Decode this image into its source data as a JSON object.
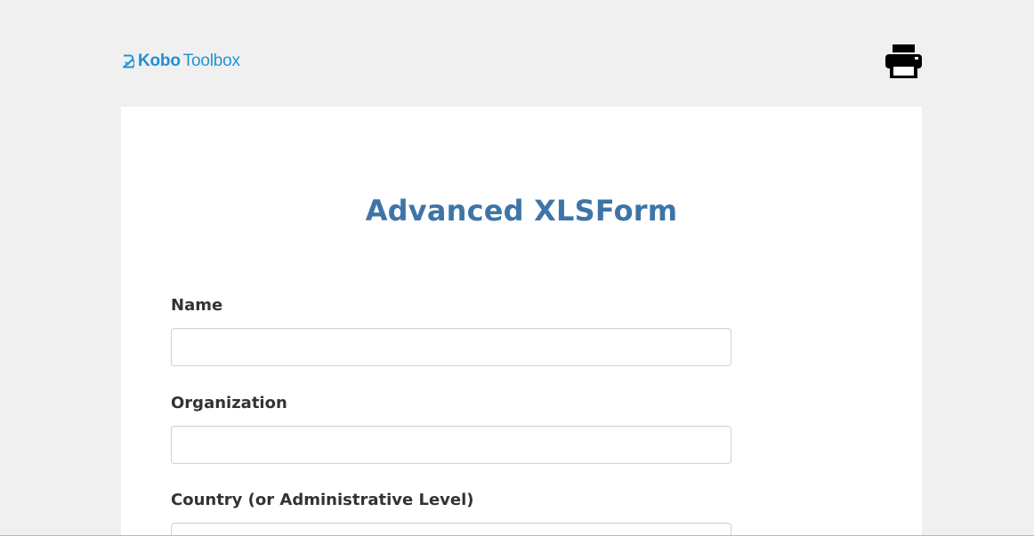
{
  "header": {
    "logo": {
      "part_bold": "Kobo",
      "part_light": "Toolbox",
      "brand_color": "#2095d9"
    },
    "print_button": {
      "icon": "print-icon"
    }
  },
  "form": {
    "title": "Advanced XLSForm",
    "title_color": "#3e75a8",
    "questions": [
      {
        "label": "Name",
        "value": ""
      },
      {
        "label": "Organization",
        "value": ""
      },
      {
        "label": "Country (or Administrative Level)",
        "value": ""
      }
    ]
  }
}
